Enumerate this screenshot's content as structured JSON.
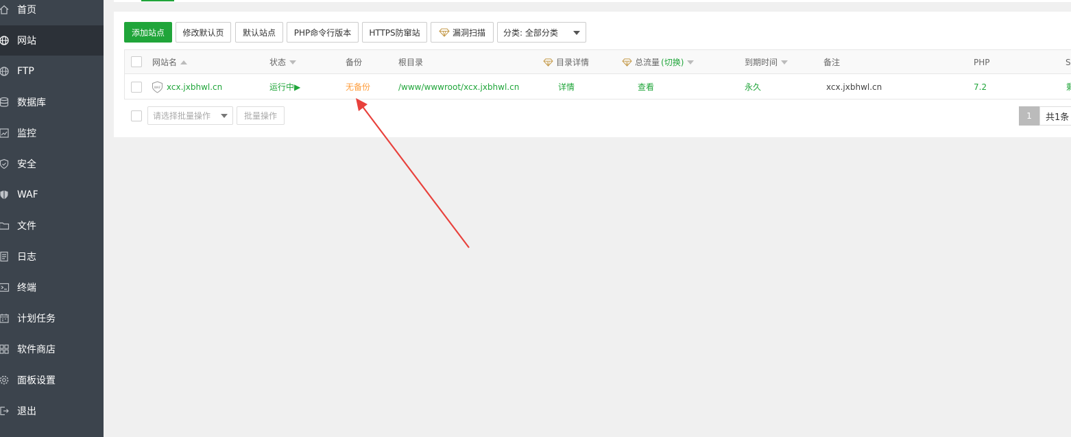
{
  "sidebar": {
    "items": [
      {
        "label": "首页",
        "icon": "home-icon"
      },
      {
        "label": "网站",
        "icon": "globe-icon",
        "active": true
      },
      {
        "label": "FTP",
        "icon": "ftp-globe-icon"
      },
      {
        "label": "数据库",
        "icon": "database-icon"
      },
      {
        "label": "监控",
        "icon": "monitor-icon"
      },
      {
        "label": "安全",
        "icon": "shield-icon"
      },
      {
        "label": "WAF",
        "icon": "waf-shield-icon"
      },
      {
        "label": "文件",
        "icon": "folder-icon"
      },
      {
        "label": "日志",
        "icon": "log-icon"
      },
      {
        "label": "终端",
        "icon": "terminal-icon"
      },
      {
        "label": "计划任务",
        "icon": "calendar-icon"
      },
      {
        "label": "软件商店",
        "icon": "grid-icon"
      },
      {
        "label": "面板设置",
        "icon": "gear-icon"
      },
      {
        "label": "退出",
        "icon": "logout-icon"
      }
    ]
  },
  "toolbar": {
    "add_site": "添加站点",
    "edit_default_page": "修改默认页",
    "default_site": "默认站点",
    "php_cli_version": "PHP命令行版本",
    "https_protect": "HTTPS防窜站",
    "vuln_scan": "漏洞扫描",
    "category": "分类: 全部分类"
  },
  "table": {
    "headers": {
      "site_name": "网站名",
      "status": "状态",
      "backup": "备份",
      "root_dir": "根目录",
      "dir_detail": "目录详情",
      "total_traffic": "总流量",
      "traffic_switch": "(切换)",
      "expire": "到期时间",
      "remark": "备注",
      "php": "PHP",
      "ssl": "S"
    },
    "rows": [
      {
        "site_name": "xcx.jxbhwl.cn",
        "badge": "WAF",
        "status": "运行中▶",
        "backup": "无备份",
        "root_dir": "/www/wwwroot/xcx.jxbhwl.cn",
        "dir_detail": "详情",
        "total_traffic": "查看",
        "expire": "永久",
        "remark": "xcx.jxbhwl.cn",
        "php": "7.2",
        "ssl": "剩"
      }
    ]
  },
  "footer": {
    "batch_placeholder": "请选择批量操作",
    "batch_button": "批量操作",
    "page": "1",
    "total": "共1条"
  },
  "colors": {
    "accent": "#20a53a",
    "sidebar": "#3c444d",
    "warning": "#ff9e3d",
    "arrow": "#e8413c"
  }
}
